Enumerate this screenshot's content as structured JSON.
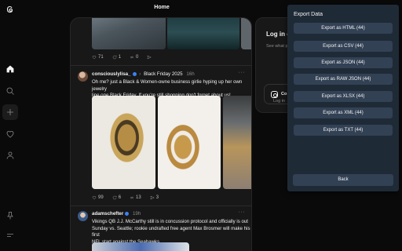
{
  "header": {
    "title": "Home"
  },
  "nav": {
    "icons": [
      "threads-logo-icon",
      "home-icon",
      "search-icon",
      "create-icon",
      "heart-icon",
      "profile-icon",
      "pin-icon",
      "menu-icon"
    ]
  },
  "feed": {
    "top_post_actions": {
      "likes": "71",
      "comments": "1",
      "reposts": "0"
    },
    "post1": {
      "username": "consciouslylisa_",
      "tag": "Black Friday 2025",
      "time": "16h",
      "text_lines": [
        "Oh me? just a Black & Women-owne business girlie hyping up her own jewelry",
        "line one Black Friday. If you're still shopping don't forget about us!"
      ],
      "actions": {
        "likes": "99",
        "comments": "6",
        "reposts": "13",
        "shares": "3"
      }
    },
    "post2": {
      "username": "adamschefter",
      "time": "19h",
      "text_lines": [
        "Vikings QB J.J. McCarthy still is in concussion protocol and officially is out",
        "Sunday vs. Seattle; rookie undrafted free agent Max Brosmer will make his first",
        "NFL start against the Seahawks."
      ]
    }
  },
  "login": {
    "title": "Log in o",
    "subtitle_lines": [
      "See what p",
      "jo"
    ],
    "button_label": "Co",
    "under": "Log in"
  },
  "export_panel": {
    "title": "Export Data",
    "options": [
      "Export as HTML (44)",
      "Export as CSV (44)",
      "Export as JSON (44)",
      "Export as RAW JSON (44)",
      "Export as XLSX (44)",
      "Export as XML (44)",
      "Export as TXT (44)"
    ],
    "back_label": "Back",
    "accent": "#1f2a37",
    "button_color": "#334155"
  }
}
